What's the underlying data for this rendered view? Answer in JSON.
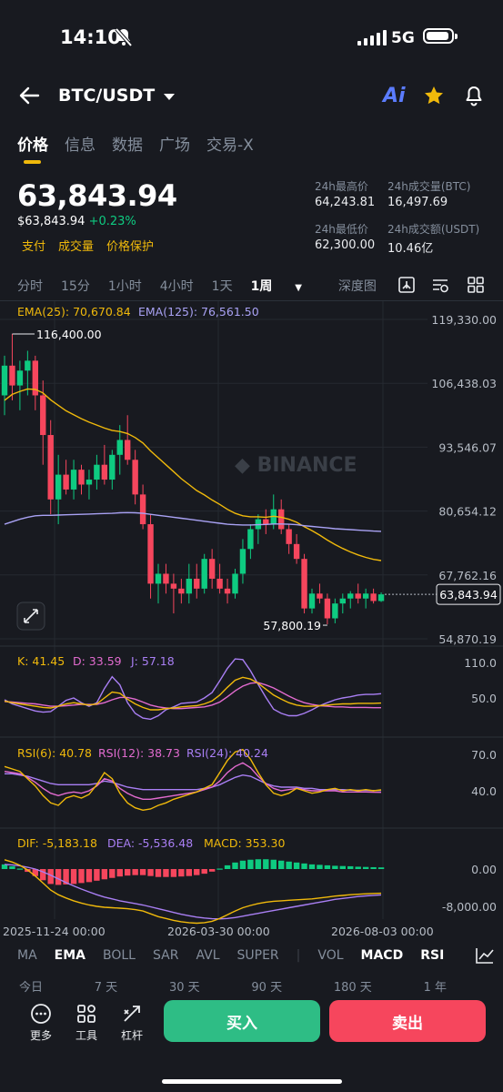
{
  "status_bar": {
    "time": "14:10",
    "network": "5G"
  },
  "header": {
    "pair": "BTC/USDT",
    "ai_label": "Ai"
  },
  "tabs": [
    "价格",
    "信息",
    "数据",
    "广场",
    "交易-X"
  ],
  "price": {
    "last": "63,843.94",
    "fiat": "$63,843.94",
    "change": "+0.23%",
    "badges": [
      "支付",
      "成交量",
      "价格保护"
    ],
    "high_label": "24h最高价",
    "high": "64,243.81",
    "low_label": "24h最低价",
    "low": "62,300.00",
    "vol_btc_label": "24h成交量(BTC)",
    "vol_btc": "16,497.69",
    "vol_usdt_label": "24h成交额(USDT)",
    "vol_usdt": "10.46亿"
  },
  "timeframes": [
    "分时",
    "15分",
    "1小时",
    "4小时",
    "1天",
    "1周",
    "深度图"
  ],
  "active_timeframe": "1周",
  "chart_data": {
    "type": "candlestick",
    "ema25_label": "EMA(25): 70,670.84",
    "ema125_label": "EMA(125): 76,561.50",
    "y_ticks": [
      "119,330.00",
      "106,438.03",
      "93,546.07",
      "80,654.12",
      "67,762.16",
      "54,870.19"
    ],
    "y_tick_values": [
      119330,
      106438.03,
      93546.07,
      80654.12,
      67762.16,
      54870.19
    ],
    "current_price_tag": "63,843.94",
    "current_price": 63843.94,
    "high_marker": "116,400.00",
    "high_value": 116400,
    "low_marker": "57,800.19",
    "low_value": 57800.19,
    "watermark": "BINANCE",
    "candles": [
      [
        104000,
        112000,
        100000,
        110000
      ],
      [
        110000,
        116400,
        103000,
        106000
      ],
      [
        106000,
        111000,
        101000,
        109000
      ],
      [
        109000,
        113000,
        104000,
        111000
      ],
      [
        111000,
        112000,
        101000,
        104000
      ],
      [
        104000,
        107000,
        90000,
        96000
      ],
      [
        96000,
        99000,
        80000,
        83000
      ],
      [
        83000,
        92000,
        78000,
        88000
      ],
      [
        88000,
        91000,
        84000,
        85000
      ],
      [
        85000,
        91000,
        83000,
        89000
      ],
      [
        89000,
        90000,
        84000,
        86000
      ],
      [
        86000,
        89000,
        83000,
        87000
      ],
      [
        87000,
        92000,
        85000,
        90000
      ],
      [
        90000,
        94000,
        86000,
        87000
      ],
      [
        87000,
        93000,
        85000,
        92000
      ],
      [
        92000,
        98000,
        88000,
        95000
      ],
      [
        95000,
        100000,
        90000,
        91000
      ],
      [
        91000,
        93000,
        82000,
        84000
      ],
      [
        84000,
        86000,
        77000,
        78000
      ],
      [
        78000,
        80000,
        63000,
        66000
      ],
      [
        66000,
        70000,
        62000,
        68000
      ],
      [
        68000,
        70000,
        64000,
        66000
      ],
      [
        66000,
        68000,
        60000,
        65000
      ],
      [
        65000,
        67000,
        62000,
        64000
      ],
      [
        64000,
        70000,
        62000,
        67000
      ],
      [
        67000,
        70000,
        63000,
        65000
      ],
      [
        65000,
        72000,
        64000,
        71000
      ],
      [
        71000,
        73000,
        65000,
        67000
      ],
      [
        67000,
        70000,
        64000,
        65000
      ],
      [
        65000,
        67000,
        62000,
        64000
      ],
      [
        64000,
        69000,
        63000,
        68000
      ],
      [
        68000,
        75000,
        66000,
        73000
      ],
      [
        73000,
        78000,
        71000,
        77000
      ],
      [
        77000,
        80000,
        74000,
        79000
      ],
      [
        79000,
        81000,
        76000,
        78000
      ],
      [
        78000,
        84000,
        77000,
        81000
      ],
      [
        81000,
        83000,
        76000,
        77000
      ],
      [
        77000,
        78000,
        72000,
        74000
      ],
      [
        74000,
        76000,
        70000,
        71000
      ],
      [
        71000,
        72000,
        60000,
        61000
      ],
      [
        61000,
        65000,
        60000,
        64000
      ],
      [
        64000,
        66000,
        62000,
        63000
      ],
      [
        63000,
        64000,
        57800,
        59000
      ],
      [
        59000,
        63000,
        58000,
        62000
      ],
      [
        62000,
        64000,
        60000,
        63000
      ],
      [
        63000,
        64500,
        61000,
        64000
      ],
      [
        64000,
        66000,
        62000,
        63000
      ],
      [
        63000,
        65000,
        61000,
        64000
      ],
      [
        64000,
        65000,
        62000,
        62500
      ],
      [
        62500,
        64243,
        62300,
        63843.94
      ]
    ],
    "ema25": [
      103000,
      104200,
      104800,
      105300,
      105200,
      104500,
      103100,
      102000,
      100900,
      100100,
      99300,
      98600,
      98000,
      97400,
      96900,
      96700,
      96300,
      95500,
      94400,
      92800,
      91400,
      90000,
      88600,
      87200,
      86000,
      84800,
      83900,
      82900,
      82000,
      81000,
      80200,
      79700,
      79500,
      79500,
      79400,
      79600,
      79400,
      79000,
      78400,
      77500,
      76700,
      75800,
      74800,
      73900,
      73100,
      72400,
      71800,
      71300,
      70900,
      70670.84
    ],
    "ema125": [
      78000,
      78500,
      79000,
      79400,
      79700,
      79800,
      79800,
      79850,
      79900,
      79950,
      80000,
      80050,
      80100,
      80150,
      80200,
      80300,
      80350,
      80300,
      80200,
      80000,
      79800,
      79600,
      79400,
      79200,
      79000,
      78800,
      78600,
      78400,
      78200,
      78000,
      77900,
      77850,
      77850,
      77900,
      77950,
      78050,
      78050,
      78000,
      77900,
      77700,
      77550,
      77400,
      77250,
      77100,
      77000,
      76900,
      76800,
      76700,
      76620,
      76561.5
    ],
    "kdj": {
      "label_k": "K: 41.45",
      "label_d": "D: 33.59",
      "label_j": "J: 57.18",
      "ticks": [
        "110.0",
        "50.0"
      ],
      "tick_values": [
        110,
        50
      ],
      "k": [
        45,
        42,
        40,
        38,
        36,
        34,
        33,
        36,
        40,
        42,
        40,
        38,
        40,
        50,
        60,
        58,
        48,
        40,
        34,
        30,
        30,
        32,
        33,
        35,
        36,
        37,
        40,
        45,
        55,
        68,
        80,
        85,
        82,
        75,
        65,
        55,
        48,
        42,
        38,
        36,
        36,
        37,
        38,
        39,
        40,
        40,
        41,
        41,
        41,
        41.45
      ],
      "d": [
        44,
        43,
        42,
        41,
        40,
        38,
        36,
        36,
        37,
        38,
        39,
        39,
        39,
        42,
        47,
        51,
        51,
        48,
        43,
        38,
        35,
        33,
        32,
        32,
        33,
        34,
        35,
        38,
        43,
        52,
        62,
        70,
        75,
        76,
        72,
        67,
        60,
        53,
        47,
        42,
        39,
        37,
        36,
        35,
        35,
        34,
        34,
        34,
        33.5,
        33.59
      ],
      "j": [
        47,
        40,
        36,
        32,
        28,
        26,
        27,
        36,
        46,
        50,
        42,
        36,
        42,
        66,
        86,
        72,
        42,
        24,
        16,
        14,
        20,
        30,
        35,
        41,
        42,
        43,
        50,
        59,
        79,
        100,
        116,
        115,
        96,
        73,
        51,
        31,
        24,
        20,
        20,
        24,
        30,
        37,
        42,
        47,
        50,
        52,
        55,
        56,
        56,
        57.18
      ]
    },
    "rsi": {
      "label_6": "RSI(6): 40.78",
      "label_12": "RSI(12): 38.73",
      "label_24": "RSI(24): 40.24",
      "ticks": [
        "70.0",
        "40.0"
      ],
      "tick_values": [
        70,
        40
      ],
      "rsi6": [
        60,
        58,
        56,
        50,
        44,
        36,
        30,
        28,
        34,
        36,
        34,
        37,
        45,
        55,
        50,
        38,
        30,
        26,
        24,
        25,
        28,
        30,
        33,
        35,
        37,
        39,
        42,
        45,
        55,
        65,
        72,
        74,
        66,
        55,
        45,
        38,
        36,
        38,
        42,
        40,
        38,
        39,
        41,
        42,
        40,
        41,
        40,
        41,
        40,
        40.78
      ],
      "rsi12": [
        56,
        55,
        54,
        51,
        47,
        42,
        38,
        36,
        38,
        39,
        38,
        40,
        44,
        50,
        48,
        42,
        38,
        35,
        33,
        33,
        34,
        35,
        36,
        37,
        38,
        39,
        41,
        43,
        48,
        55,
        60,
        63,
        59,
        52,
        46,
        42,
        40,
        41,
        42,
        41,
        40,
        40,
        40,
        40,
        39,
        39,
        39,
        39,
        38.8,
        38.73
      ],
      "rsi24": [
        54,
        54,
        53,
        52,
        50,
        48,
        46,
        45,
        45,
        45,
        45,
        45,
        46,
        48,
        47,
        45,
        43,
        42,
        41,
        41,
        41,
        41,
        41,
        41,
        41,
        41,
        42,
        43,
        45,
        48,
        51,
        53,
        52,
        49,
        46,
        44,
        43,
        43,
        43,
        42,
        42,
        41,
        41,
        41,
        41,
        40.5,
        40.4,
        40.3,
        40.25,
        40.24
      ]
    },
    "macd": {
      "label_dif": "DIF: -5,183.18",
      "label_dea": "DEA: -5,536.48",
      "label_macd": "MACD: 353.30",
      "ticks": [
        "0.00",
        "-8,000.00"
      ],
      "tick_values": [
        0,
        -8000
      ],
      "dif": [
        2000,
        1500,
        800,
        -200,
        -1500,
        -3000,
        -4500,
        -5500,
        -6200,
        -6800,
        -7300,
        -7700,
        -8000,
        -8200,
        -8300,
        -8400,
        -8500,
        -8700,
        -9000,
        -9600,
        -10200,
        -10600,
        -11000,
        -11300,
        -11500,
        -11600,
        -11500,
        -11200,
        -10600,
        -9800,
        -9000,
        -8300,
        -7800,
        -7400,
        -7100,
        -6900,
        -6800,
        -6700,
        -6600,
        -6500,
        -6400,
        -6200,
        -6000,
        -5800,
        -5650,
        -5500,
        -5400,
        -5300,
        -5230,
        -5183.18
      ],
      "dea": [
        1000,
        900,
        700,
        400,
        0,
        -600,
        -1300,
        -2100,
        -2900,
        -3600,
        -4300,
        -4900,
        -5500,
        -6000,
        -6400,
        -6800,
        -7100,
        -7400,
        -7700,
        -8100,
        -8500,
        -8900,
        -9300,
        -9700,
        -10000,
        -10300,
        -10500,
        -10650,
        -10700,
        -10600,
        -10400,
        -10100,
        -9800,
        -9500,
        -9200,
        -8900,
        -8600,
        -8300,
        -8000,
        -7700,
        -7400,
        -7100,
        -6800,
        -6500,
        -6300,
        -6100,
        -5900,
        -5750,
        -5630,
        -5536.48
      ],
      "hist": [
        1000,
        600,
        100,
        -600,
        -1500,
        -2400,
        -3200,
        -3400,
        -3300,
        -3200,
        -3000,
        -2800,
        -2500,
        -2200,
        -1900,
        -1600,
        -1400,
        -1300,
        -1300,
        -1500,
        -1700,
        -1700,
        -1700,
        -1600,
        -1500,
        -1300,
        -1000,
        -550,
        100,
        800,
        1400,
        1800,
        2000,
        2100,
        2100,
        2000,
        1800,
        1600,
        1400,
        1200,
        1000,
        900,
        800,
        700,
        650,
        600,
        500,
        450,
        400,
        353.3
      ]
    },
    "x_ticks": [
      "2025-11-24 00:00",
      "2026-03-30 00:00",
      "2026-08-03 00:00"
    ],
    "colors": {
      "up": "#0ecb81",
      "down": "#f6465d",
      "ema25": "#f0b90b",
      "ema125": "#a9a2f4",
      "k": "#f0b90b",
      "d": "#e26bcf",
      "j": "#a97ff4"
    }
  },
  "indicators": [
    "MA",
    "EMA",
    "BOLL",
    "SAR",
    "AVL",
    "SUPER",
    "VOL",
    "MACD",
    "RSI"
  ],
  "active_indicators": [
    "EMA",
    "MACD",
    "RSI"
  ],
  "performance": [
    "今日",
    "7 天",
    "30 天",
    "90 天",
    "180 天",
    "1 年"
  ],
  "bottom": {
    "more": "更多",
    "tools": "工具",
    "leverage": "杠杆",
    "buy": "买入",
    "sell": "卖出"
  }
}
